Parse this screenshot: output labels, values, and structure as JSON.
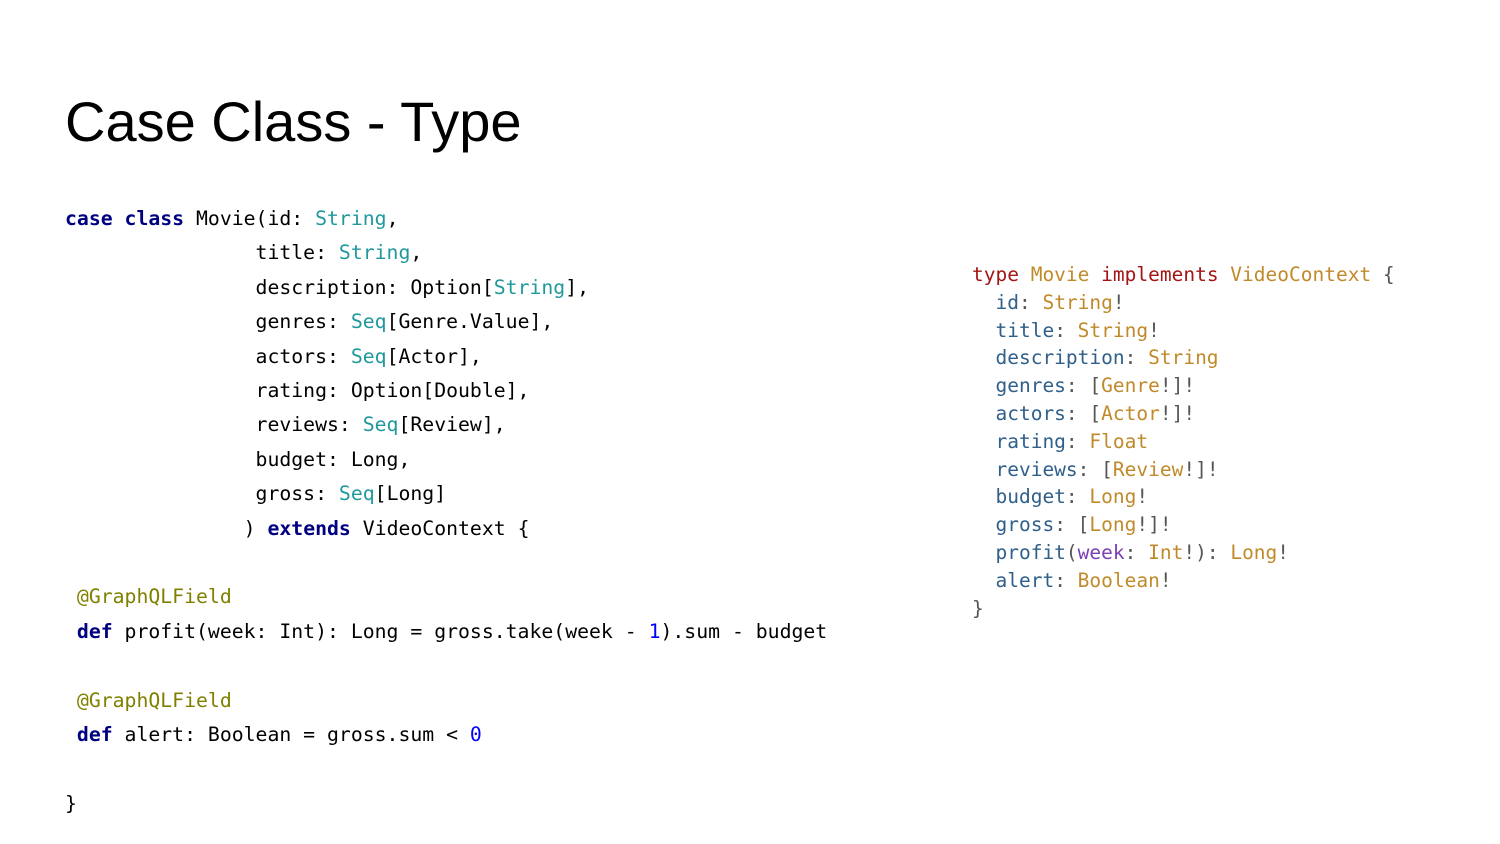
{
  "slide": {
    "title": "Case Class - Type"
  },
  "colors": {
    "scala_keyword": "#000080",
    "scala_type": "#20999d",
    "scala_annotation": "#808000",
    "scala_number": "#0000ff",
    "graphql_keyword": "#a31515",
    "graphql_type": "#c08a2a",
    "graphql_field": "#2f5f8a",
    "graphql_argument": "#7a3fb3"
  },
  "scala_code": {
    "lines": [
      [
        [
          "kw",
          "case class"
        ],
        [
          "",
          "Movie(id: "
        ],
        [
          "ty",
          "String"
        ],
        [
          "",
          ","
        ]
      ],
      [
        [
          "",
          "                title: "
        ],
        [
          "ty",
          "String"
        ],
        [
          "",
          ","
        ]
      ],
      [
        [
          "",
          "                description: Option["
        ],
        [
          "ty",
          "String"
        ],
        [
          "",
          "],"
        ]
      ],
      [
        [
          "",
          "                genres: "
        ],
        [
          "ty",
          "Seq"
        ],
        [
          "",
          "[Genre.Value],"
        ]
      ],
      [
        [
          "",
          "                actors: "
        ],
        [
          "ty",
          "Seq"
        ],
        [
          "",
          "[Actor],"
        ]
      ],
      [
        [
          "",
          "                rating: Option[Double],"
        ]
      ],
      [
        [
          "",
          "                reviews: "
        ],
        [
          "ty",
          "Seq"
        ],
        [
          "",
          "[Review],"
        ]
      ],
      [
        [
          "",
          "                budget: Long,"
        ]
      ],
      [
        [
          "",
          "                gross: "
        ],
        [
          "ty",
          "Seq"
        ],
        [
          "",
          "[Long]"
        ]
      ],
      [
        [
          "",
          "               ) "
        ],
        [
          "kw",
          "extends"
        ],
        [
          "",
          "VideoContext {"
        ]
      ],
      [],
      [
        [
          "ann",
          " @GraphQLField"
        ]
      ],
      [
        [
          "kw",
          " def"
        ],
        [
          "",
          "profit(week: Int): Long = gross.take(week - "
        ],
        [
          "num",
          "1"
        ],
        [
          "",
          ").sum - budget"
        ]
      ],
      [],
      [
        [
          "ann",
          " @GraphQLField"
        ]
      ],
      [
        [
          "kw",
          " def"
        ],
        [
          "",
          "alert: Boolean = gross.sum < "
        ],
        [
          "num",
          "0"
        ]
      ],
      [],
      [
        [
          "",
          "}"
        ]
      ]
    ]
  },
  "graphql_code": {
    "lines": [
      [
        [
          "gkw",
          "type"
        ],
        [
          "gty",
          "Movie"
        ],
        [
          "gkw",
          "implements"
        ],
        [
          "gty",
          "VideoContext"
        ],
        [
          "gp",
          "{"
        ]
      ],
      [
        [
          "gfld",
          "  id"
        ],
        [
          "gp",
          ": "
        ],
        [
          "gty",
          "String"
        ],
        [
          "gp",
          "!"
        ]
      ],
      [
        [
          "gfld",
          "  title"
        ],
        [
          "gp",
          ": "
        ],
        [
          "gty",
          "String"
        ],
        [
          "gp",
          "!"
        ]
      ],
      [
        [
          "gfld",
          "  description"
        ],
        [
          "gp",
          ": "
        ],
        [
          "gty",
          "String"
        ]
      ],
      [
        [
          "gfld",
          "  genres"
        ],
        [
          "gp",
          ": ["
        ],
        [
          "gty",
          "Genre"
        ],
        [
          "gp",
          "!]!"
        ]
      ],
      [
        [
          "gfld",
          "  actors"
        ],
        [
          "gp",
          ": ["
        ],
        [
          "gty",
          "Actor"
        ],
        [
          "gp",
          "!]!"
        ]
      ],
      [
        [
          "gfld",
          "  rating"
        ],
        [
          "gp",
          ": "
        ],
        [
          "gty",
          "Float"
        ]
      ],
      [
        [
          "gfld",
          "  reviews"
        ],
        [
          "gp",
          ": ["
        ],
        [
          "gty",
          "Review"
        ],
        [
          "gp",
          "!]!"
        ]
      ],
      [
        [
          "gfld",
          "  budget"
        ],
        [
          "gp",
          ": "
        ],
        [
          "gty",
          "Long"
        ],
        [
          "gp",
          "!"
        ]
      ],
      [
        [
          "gfld",
          "  gross"
        ],
        [
          "gp",
          ": ["
        ],
        [
          "gty",
          "Long"
        ],
        [
          "gp",
          "!]!"
        ]
      ],
      [
        [
          "gfld",
          "  profit"
        ],
        [
          "gp",
          "("
        ],
        [
          "garg",
          "week"
        ],
        [
          "gp",
          ": "
        ],
        [
          "gty",
          "Int"
        ],
        [
          "gp",
          "!): "
        ],
        [
          "gty",
          "Long"
        ],
        [
          "gp",
          "!"
        ]
      ],
      [
        [
          "gfld",
          "  alert"
        ],
        [
          "gp",
          ": "
        ],
        [
          "gty",
          "Boolean"
        ],
        [
          "gp",
          "!"
        ]
      ],
      [
        [
          "gp",
          "}"
        ]
      ]
    ]
  }
}
